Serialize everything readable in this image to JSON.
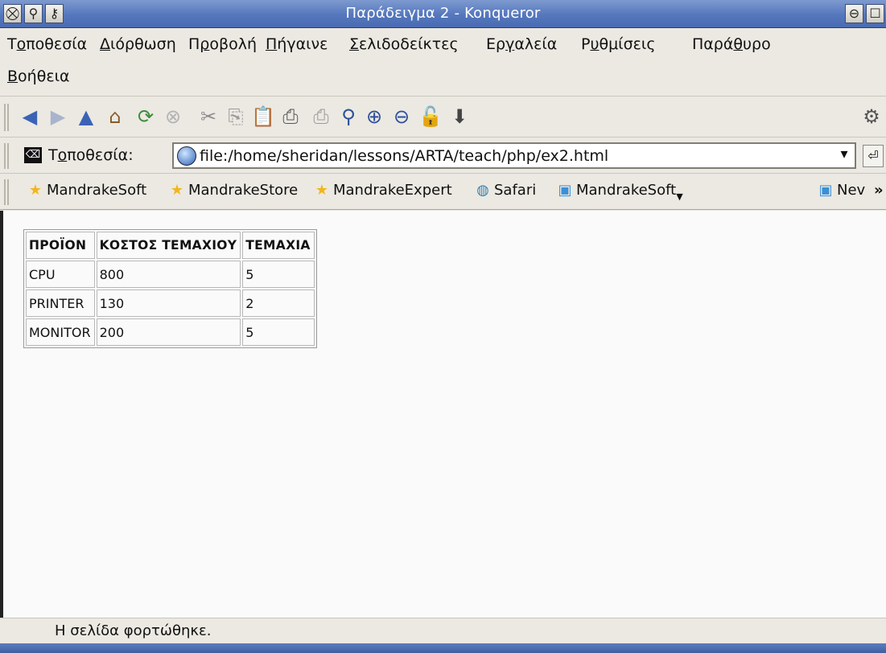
{
  "window": {
    "title": "Παράδειγμα 2 - Konqueror",
    "left_buttons": [
      "⛒",
      "⚲",
      "⚷"
    ],
    "right_buttons": [
      "⊖",
      "☐"
    ]
  },
  "menubar": {
    "items": [
      {
        "pre": "Τ",
        "ul": "ο",
        "post": "ποθεσία"
      },
      {
        "pre": "",
        "ul": "Δ",
        "post": "ιόρθωση"
      },
      {
        "pre": "Π",
        "ul": "ρ",
        "post": "οβολή"
      },
      {
        "pre": "",
        "ul": "Π",
        "post": "ήγαινε"
      },
      {
        "pre": "",
        "ul": "Σ",
        "post": "ελιδοδείκτες"
      },
      {
        "pre": "Ερ",
        "ul": "γ",
        "post": "αλεία"
      },
      {
        "pre": "Ρ",
        "ul": "υ",
        "post": "θμίσεις"
      },
      {
        "pre": "Παρά",
        "ul": "θ",
        "post": "υρο"
      },
      {
        "pre": "",
        "ul": "Β",
        "post": "οήθεια"
      }
    ]
  },
  "toolbar": {
    "icons": [
      {
        "name": "back-icon",
        "glyph": "◀",
        "color": "#3b63b5"
      },
      {
        "name": "forward-icon",
        "glyph": "▶",
        "color": "#a9b4cc"
      },
      {
        "name": "up-icon",
        "glyph": "▲",
        "color": "#3b63b5"
      },
      {
        "name": "home-icon",
        "glyph": "⌂",
        "color": "#8a5a2b"
      },
      {
        "name": "reload-icon",
        "glyph": "⟳",
        "color": "#3f8d3a"
      },
      {
        "name": "stop-icon",
        "glyph": "⊗",
        "color": "#b3b3b3"
      },
      {
        "name": "cut-icon",
        "glyph": "✂",
        "color": "#8a8a8a"
      },
      {
        "name": "copy-icon",
        "glyph": "⎘",
        "color": "#9a9a9a"
      },
      {
        "name": "paste-icon",
        "glyph": "📋",
        "color": "#9a9a9a"
      },
      {
        "name": "print-icon",
        "glyph": "⎙",
        "color": "#555555"
      },
      {
        "name": "print-frame-icon",
        "glyph": "⎙",
        "color": "#9a9a9a"
      },
      {
        "name": "find-icon",
        "glyph": "⚲",
        "color": "#2e4f9c"
      },
      {
        "name": "zoom-in-icon",
        "glyph": "⊕",
        "color": "#2e4f9c"
      },
      {
        "name": "zoom-out-icon",
        "glyph": "⊖",
        "color": "#2e4f9c"
      },
      {
        "name": "unlock-icon",
        "glyph": "🔓",
        "color": "#333333"
      },
      {
        "name": "download-icon",
        "glyph": "⬇",
        "color": "#444444"
      }
    ],
    "settings_icon": "⚙"
  },
  "location": {
    "label_pre": "Τ",
    "label_ul": "ο",
    "label_post": "ποθεσία:",
    "url": "file:/home/sheridan/lessons/ARTA/teach/php/ex2.html",
    "dropdown": "▾",
    "go": "⏎"
  },
  "bookmarks": {
    "items": [
      {
        "label": "MandrakeSoft",
        "icon": "★",
        "color": "#f2b51c"
      },
      {
        "label": "MandrakeStore",
        "icon": "★",
        "color": "#f2b51c"
      },
      {
        "label": "MandrakeExpert",
        "icon": "★",
        "color": "#f2b51c"
      },
      {
        "label": "Safari",
        "icon": "◍",
        "color": "#3a7fb0"
      },
      {
        "label": "MandrakeSoft",
        "icon": "▣",
        "color": "#3a8fd8"
      },
      {
        "label": "Nev",
        "icon": "▣",
        "color": "#3a8fd8"
      }
    ],
    "overflow": "»"
  },
  "table": {
    "headers": [
      "ΠΡΟΪΟΝ",
      "ΚΟΣΤΟΣ ΤΕΜΑΧΙΟΥ",
      "ΤΕΜΑΧΙΑ"
    ],
    "rows": [
      [
        "CPU",
        "800",
        "5"
      ],
      [
        "PRINTER",
        "130",
        "2"
      ],
      [
        "MONITOR",
        "200",
        "5"
      ]
    ]
  },
  "status": {
    "text": "Η σελίδα φορτώθηκε."
  }
}
